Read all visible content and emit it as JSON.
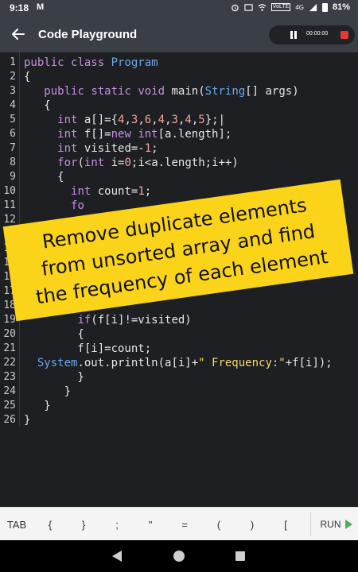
{
  "status_bar": {
    "time": "9:18",
    "mail_icon": "M",
    "network_label": "VoLTE",
    "network_gen": "4G",
    "battery": "81%",
    "icons": [
      "alarm-icon",
      "cast-icon",
      "wifi-icon",
      "signal-icon",
      "battery-icon"
    ]
  },
  "app_bar": {
    "title": "Code Playground",
    "back_icon": "arrow-left-icon",
    "recorder": {
      "time": "00:00:00"
    }
  },
  "editor": {
    "lines": [
      {
        "n": "1",
        "segs": [
          [
            "kw",
            "public "
          ],
          [
            "kw",
            "class "
          ],
          [
            "cl",
            "Program"
          ]
        ]
      },
      {
        "n": "2",
        "segs": [
          [
            "pl",
            "{"
          ]
        ]
      },
      {
        "n": "3",
        "segs": [
          [
            "pl",
            "   "
          ],
          [
            "kw",
            "public "
          ],
          [
            "kw",
            "static "
          ],
          [
            "kw",
            "void "
          ],
          [
            "pl",
            "main("
          ],
          [
            "cl",
            "String"
          ],
          [
            "pl",
            "[] args)"
          ]
        ]
      },
      {
        "n": "4",
        "segs": [
          [
            "pl",
            "   {"
          ]
        ]
      },
      {
        "n": "5",
        "segs": [
          [
            "pl",
            "     "
          ],
          [
            "kw",
            "int "
          ],
          [
            "pl",
            "a[]={"
          ],
          [
            "num",
            "4"
          ],
          [
            "pl",
            ","
          ],
          [
            "num",
            "3"
          ],
          [
            "pl",
            ","
          ],
          [
            "num",
            "6"
          ],
          [
            "pl",
            ","
          ],
          [
            "num",
            "4"
          ],
          [
            "pl",
            ","
          ],
          [
            "num",
            "3"
          ],
          [
            "pl",
            ","
          ],
          [
            "num",
            "4"
          ],
          [
            "pl",
            ","
          ],
          [
            "num",
            "5"
          ],
          [
            "pl",
            "};|"
          ]
        ]
      },
      {
        "n": "6",
        "segs": [
          [
            "pl",
            "     "
          ],
          [
            "kw",
            "int "
          ],
          [
            "pl",
            "f[]="
          ],
          [
            "kw",
            "new "
          ],
          [
            "kw",
            "int"
          ],
          [
            "pl",
            "[a.length];"
          ]
        ]
      },
      {
        "n": "7",
        "segs": [
          [
            "pl",
            "     "
          ],
          [
            "kw",
            "int "
          ],
          [
            "pl",
            "visited=-"
          ],
          [
            "num",
            "1"
          ],
          [
            "pl",
            ";"
          ]
        ]
      },
      {
        "n": "8",
        "segs": [
          [
            "pl",
            "     "
          ],
          [
            "kw",
            "for"
          ],
          [
            "pl",
            "("
          ],
          [
            "kw",
            "int "
          ],
          [
            "pl",
            "i="
          ],
          [
            "num",
            "0"
          ],
          [
            "pl",
            ";i<a.length;i++)"
          ]
        ]
      },
      {
        "n": "9",
        "segs": [
          [
            "pl",
            "     {"
          ]
        ]
      },
      {
        "n": "10",
        "segs": [
          [
            "pl",
            "       "
          ],
          [
            "kw",
            "int "
          ],
          [
            "pl",
            "count="
          ],
          [
            "num",
            "1"
          ],
          [
            "pl",
            ";"
          ]
        ]
      },
      {
        "n": "11",
        "segs": [
          [
            "pl",
            "       "
          ],
          [
            "kw",
            "fo"
          ]
        ]
      },
      {
        "n": "12",
        "segs": [
          [
            "pl",
            ""
          ]
        ]
      },
      {
        "n": "13",
        "segs": [
          [
            "pl",
            ""
          ]
        ]
      },
      {
        "n": "14",
        "segs": [
          [
            "pl",
            ""
          ]
        ]
      },
      {
        "n": "15",
        "segs": [
          [
            "pl",
            ""
          ]
        ]
      },
      {
        "n": "16",
        "segs": [
          [
            "pl",
            ""
          ]
        ]
      },
      {
        "n": "17",
        "segs": [
          [
            "pl",
            ""
          ]
        ]
      },
      {
        "n": "18",
        "segs": [
          [
            "pl",
            "        }"
          ]
        ]
      },
      {
        "n": "19",
        "segs": [
          [
            "pl",
            "        "
          ],
          [
            "kw",
            "if"
          ],
          [
            "pl",
            "(f[i]!=visited)"
          ]
        ]
      },
      {
        "n": "20",
        "segs": [
          [
            "pl",
            "        {"
          ]
        ]
      },
      {
        "n": "21",
        "segs": [
          [
            "pl",
            "        f[i]=count;"
          ]
        ]
      },
      {
        "n": "22",
        "segs": [
          [
            "pl",
            "  "
          ],
          [
            "cl",
            "System"
          ],
          [
            "pl",
            ".out.println(a[i]+"
          ],
          [
            "str",
            "\" Frequency:\""
          ],
          [
            "pl",
            "+f[i]);"
          ]
        ]
      },
      {
        "n": "23",
        "segs": [
          [
            "pl",
            "        }"
          ]
        ]
      },
      {
        "n": "24",
        "segs": [
          [
            "pl",
            "      }"
          ]
        ]
      },
      {
        "n": "25",
        "segs": [
          [
            "pl",
            "   }"
          ]
        ]
      },
      {
        "n": "26",
        "segs": [
          [
            "pl",
            "}"
          ]
        ]
      }
    ]
  },
  "banner": {
    "lines": [
      "Remove duplicate elements",
      "from unsorted array and find",
      "the frequency of each element"
    ]
  },
  "keybar": {
    "keys": [
      "TAB",
      "{",
      "}",
      ";",
      "\"",
      "=",
      "(",
      ")",
      "["
    ],
    "run_label": "RUN"
  }
}
